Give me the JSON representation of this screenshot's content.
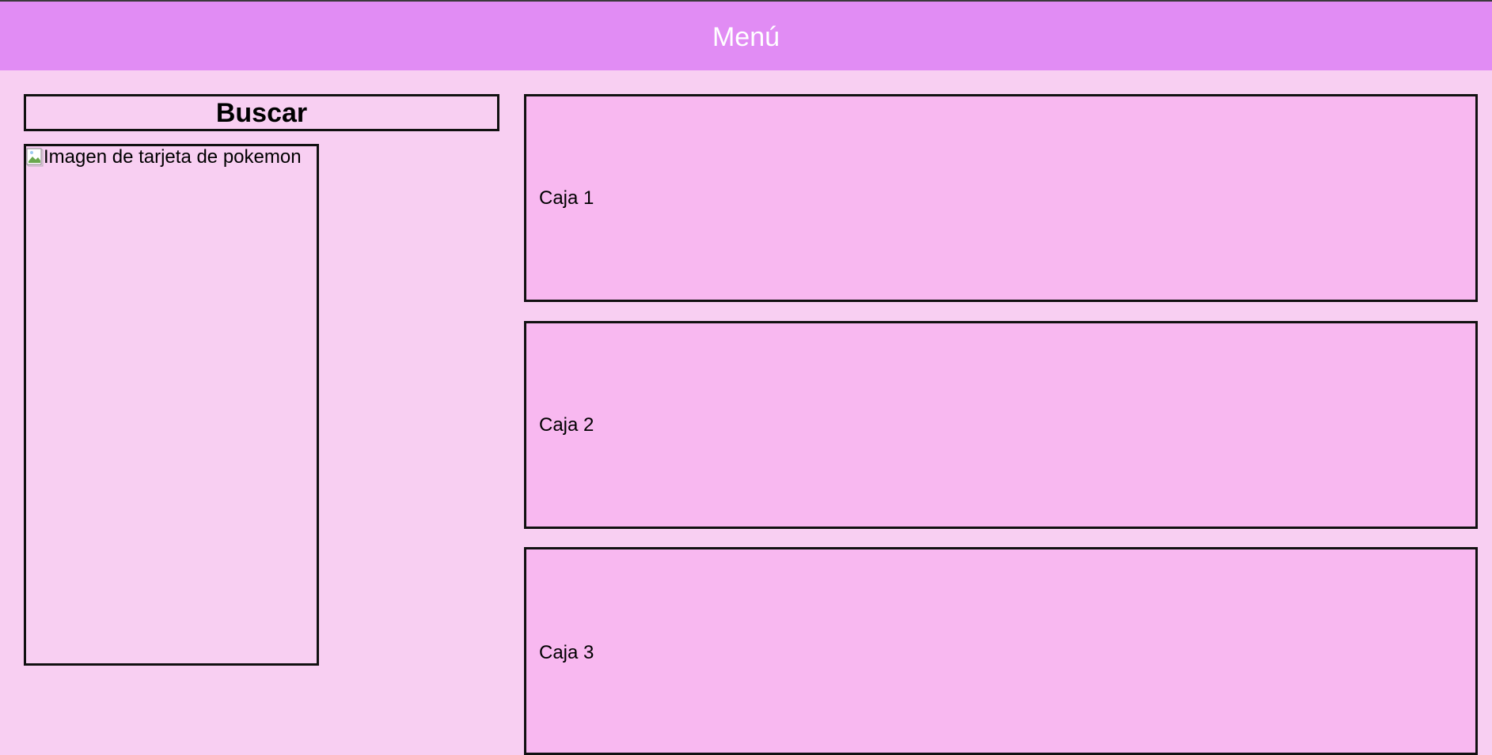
{
  "header": {
    "title": "Menú",
    "background_color": "#e18cf4",
    "title_color": "#ffffff"
  },
  "search": {
    "label": "Buscar"
  },
  "card": {
    "image_alt": "Imagen de tarjeta de pokemon",
    "icon": "broken-image-icon"
  },
  "boxes": [
    {
      "label": "Caja 1"
    },
    {
      "label": "Caja 2"
    },
    {
      "label": "Caja 3"
    }
  ],
  "colors": {
    "page_background": "#f8cff2",
    "box_background": "#f8b8f0",
    "border": "#111111"
  }
}
